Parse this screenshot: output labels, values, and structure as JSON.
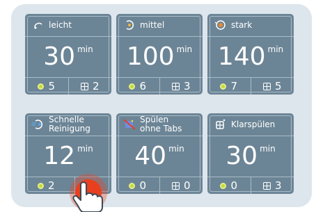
{
  "programs": [
    {
      "label": "leicht",
      "time": "30",
      "unit": "min",
      "count_a": "5",
      "count_b": "2",
      "icon": "light-wash-icon"
    },
    {
      "label": "mittel",
      "time": "100",
      "unit": "min",
      "count_a": "6",
      "count_b": "3",
      "icon": "medium-wash-icon"
    },
    {
      "label": "stark",
      "time": "140",
      "unit": "min",
      "count_a": "7",
      "count_b": "5",
      "icon": "strong-wash-icon"
    },
    {
      "label_line1": "Schnelle",
      "label_line2": "Reinigung",
      "time": "12",
      "unit": "min",
      "count_a": "2",
      "count_b": "",
      "icon": "quick-clean-icon"
    },
    {
      "label_line1": "Spülen",
      "label_line2": "ohne Tabs",
      "time": "40",
      "unit": "min",
      "count_a": "0",
      "count_b": "0",
      "icon": "rinse-no-tabs-icon"
    },
    {
      "label": "Klarspülen",
      "time": "30",
      "unit": "min",
      "count_a": "0",
      "count_b": "3",
      "icon": "rinse-aid-icon"
    }
  ],
  "colors": {
    "tile": "#6c8596",
    "panel": "#dde6ec",
    "indicator": "#c3d93b",
    "touch": "#e8401f"
  }
}
